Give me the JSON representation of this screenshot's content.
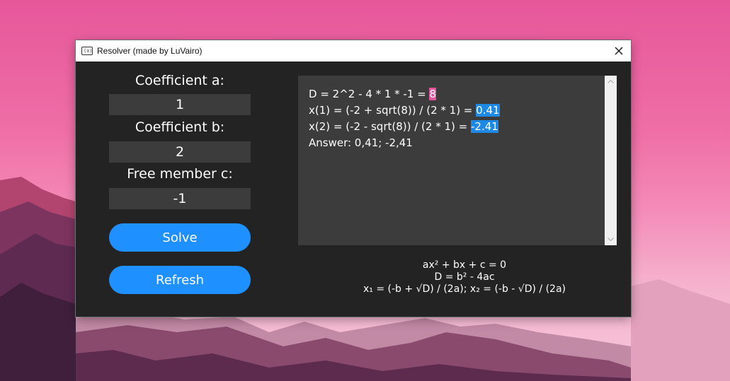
{
  "window": {
    "title": "Resolver (made by LuVairo)",
    "icon_text": "(x)"
  },
  "inputs": {
    "a_label": "Coefficient a:",
    "a_value": "1",
    "b_label": "Coefficient b:",
    "b_value": "2",
    "c_label": "Free member c:",
    "c_value": "-1"
  },
  "buttons": {
    "solve": "Solve",
    "refresh": "Refresh"
  },
  "output": {
    "line1_prefix": "D = 2^2 - 4 * 1 * -1 = ",
    "line1_value": "8",
    "line2_prefix": "x(1) = (-2 + sqrt(8)) / (2 * 1) = ",
    "line2_value": "0.41",
    "line3_prefix": "x(2) = (-2 - sqrt(8)) / (2 * 1) = ",
    "line3_value": "-2.41",
    "line4": "Answer: 0,41; -2,41"
  },
  "formulas": {
    "equation": "ax² + bx + c = 0",
    "discriminant": "D = b² - 4ac",
    "roots": "x₁ = (-b + √D) / (2a); x₂ = (-b - √D) / (2a)"
  },
  "colors": {
    "accent": "#1e90ff",
    "highlight_pink": "#e0559c",
    "window_bg": "#232323",
    "field_bg": "#3c3c3c"
  }
}
